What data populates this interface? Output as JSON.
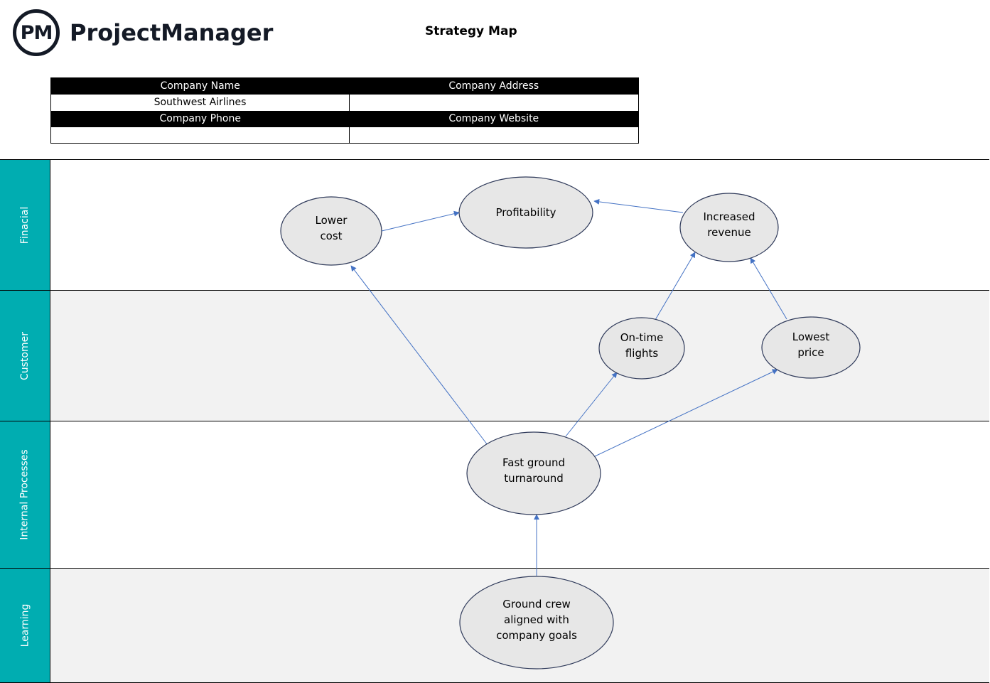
{
  "header": {
    "logo_mark": "PM",
    "logo_text": "ProjectManager",
    "title": "Strategy Map"
  },
  "company_info": {
    "headers_row1": [
      "Company Name",
      "Company Address"
    ],
    "values_row1": [
      "Southwest Airlines",
      ""
    ],
    "headers_row2": [
      "Company Phone",
      "Company Website"
    ],
    "values_row2": [
      "",
      ""
    ]
  },
  "lanes": [
    {
      "label": "Finacial",
      "shade": "white"
    },
    {
      "label": "Customer",
      "shade": "grey"
    },
    {
      "label": "Internal Processes",
      "shade": "white"
    },
    {
      "label": "Learning",
      "shade": "grey"
    }
  ],
  "nodes": [
    {
      "id": "lower-cost",
      "lane": "Finacial",
      "lines": [
        "Lower",
        "cost"
      ]
    },
    {
      "id": "profitability",
      "lane": "Finacial",
      "lines": [
        "Profitability"
      ]
    },
    {
      "id": "increased-revenue",
      "lane": "Finacial",
      "lines": [
        "Increased",
        "revenue"
      ]
    },
    {
      "id": "on-time-flights",
      "lane": "Customer",
      "lines": [
        "On-time",
        "flights"
      ]
    },
    {
      "id": "lowest-price",
      "lane": "Customer",
      "lines": [
        "Lowest",
        "price"
      ]
    },
    {
      "id": "fast-ground-turnaround",
      "lane": "Internal Processes",
      "lines": [
        "Fast ground",
        "turnaround"
      ]
    },
    {
      "id": "ground-crew-aligned",
      "lane": "Learning",
      "lines": [
        "Ground crew",
        "aligned with",
        "company goals"
      ]
    }
  ],
  "edges": [
    {
      "from": "lower-cost",
      "to": "profitability"
    },
    {
      "from": "increased-revenue",
      "to": "profitability"
    },
    {
      "from": "on-time-flights",
      "to": "increased-revenue"
    },
    {
      "from": "lowest-price",
      "to": "increased-revenue"
    },
    {
      "from": "fast-ground-turnaround",
      "to": "lower-cost"
    },
    {
      "from": "fast-ground-turnaround",
      "to": "on-time-flights"
    },
    {
      "from": "fast-ground-turnaround",
      "to": "lowest-price"
    },
    {
      "from": "ground-crew-aligned",
      "to": "fast-ground-turnaround"
    }
  ],
  "colors": {
    "lane_label_bg": "#00adb1",
    "node_fill": "#e7e7e7",
    "node_stroke": "#2f3a5a",
    "edge": "#4472c4",
    "grey_lane": "#f2f2f2"
  }
}
